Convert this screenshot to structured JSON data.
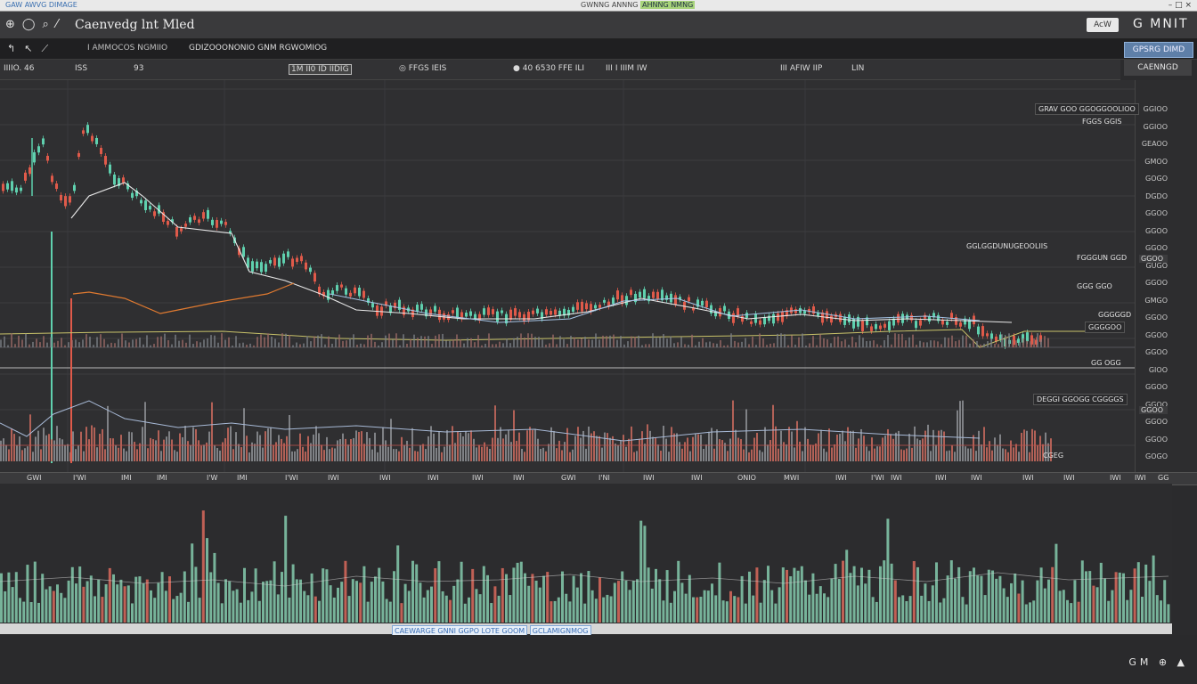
{
  "top_strip": {
    "left_text": "GAW AWVG DIMAGE",
    "mid_text": "GWNNG ANNNG ",
    "mid_highlight": "AHNNG NMNG",
    "right_text": "– □ ×"
  },
  "title_bar": {
    "title": "Caenvedg lnt Mled",
    "badge": "AcW",
    "right_text": "G MNIT"
  },
  "toolbar1": {
    "path": "I AMMOCOS NGMIIO",
    "path2": "GDIZOOONONIO GNM RGWOMIOG"
  },
  "side_buttons": {
    "primary": "GPSRG DIMD",
    "secondary": "CAENNGD"
  },
  "toolbar2": {
    "items": [
      "IIIIO. 46",
      "ISS",
      "93",
      "1M II0 ID IIDIG",
      "◎ FFGS IEIS",
      "● 40 6530 FFE ILI",
      "III I IIIM IW",
      "III AFIW IIP",
      "LIN"
    ]
  },
  "price_axis": {
    "labels": [
      "GGIOO",
      "GGIOO",
      "GEAOO",
      "GMOO",
      "GOGO",
      "DGDO",
      "GGOO",
      "GGOO",
      "GGOO",
      "GUGO",
      "GGOO",
      "GMGO",
      "GGOO",
      "GGOO",
      "GGOO",
      "GIOO",
      "GGOO",
      "GGOO",
      "GGOO",
      "GGOO",
      "GOGO"
    ],
    "tags": [
      "GGOO",
      "GGOO"
    ]
  },
  "float_labels": [
    "GRAV GOO GGOGGOOLIOO",
    "FGGS GGIS",
    "GGLGGDUNUGEOOLIIS",
    "FGGGUN GGD",
    "GGG GGO",
    "GGGGGD",
    "GGGGOO",
    "GG OGG",
    "CGEG",
    "DEGGI GGOGG CGGGGS"
  ],
  "x_axis_labels": [
    "GWI",
    "I'WI",
    "IMI",
    "IMI",
    "I'W",
    "IMI",
    "I'WI",
    "IWI",
    "IWI",
    "IWI",
    "IWI",
    "IWI",
    "GWI",
    "I'NI",
    "IWI",
    "IWI",
    "ONIO",
    "MWI",
    "IWI",
    "I'WI",
    "IWI",
    "IWI",
    "IWI",
    "IWI",
    "IWI",
    "IWI",
    "IWI",
    "GG"
  ],
  "status_bar": {
    "left": "CAEWARGE GNNI GGPO LOTE GOOM",
    "right": "GCLAMIGNMOG"
  },
  "bottom_right": "GM ⊕ ▲",
  "colors": {
    "up": "#5fd0ae",
    "down": "#e05a4a",
    "ma1": "#e8e8e8",
    "ma2": "#e07a30",
    "ma3": "#c9c36a",
    "ma4": "#a5c4e6"
  }
}
